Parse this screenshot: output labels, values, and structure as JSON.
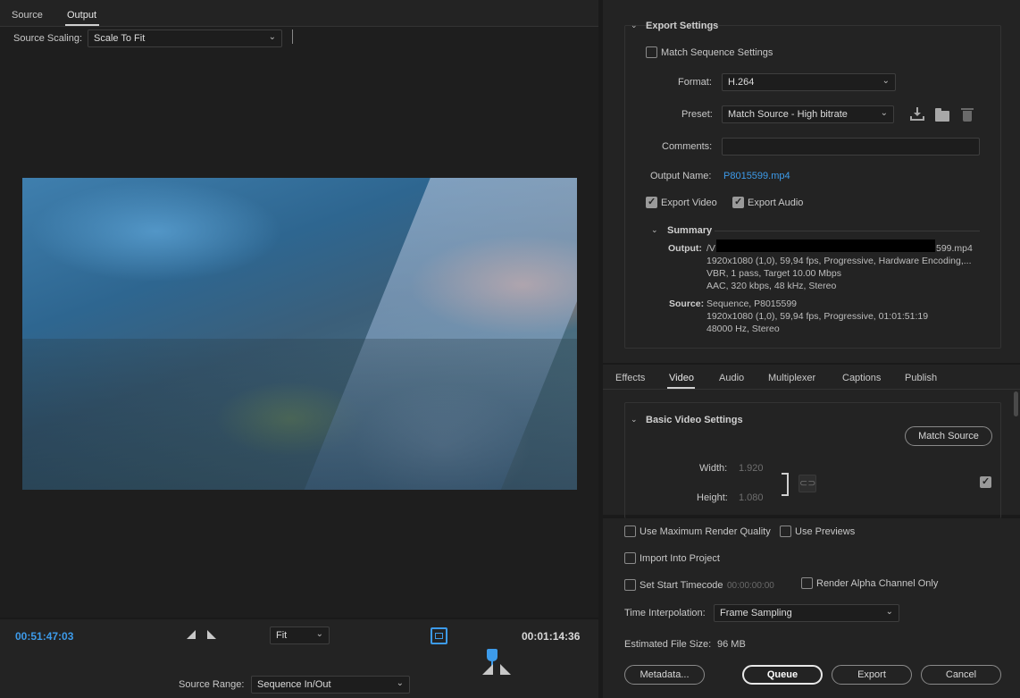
{
  "left": {
    "tabs": [
      "Source",
      "Output"
    ],
    "source_scaling_label": "Source Scaling:",
    "source_scaling_value": "Scale To Fit",
    "timecode_in": "00:51:47:03",
    "timecode_duration": "00:01:14:36",
    "zoom_value": "Fit",
    "source_range_label": "Source Range:",
    "source_range_value": "Sequence In/Out"
  },
  "export_settings": {
    "title": "Export Settings",
    "match_sequence_label": "Match Sequence Settings",
    "match_sequence_checked": false,
    "format_label": "Format:",
    "format_value": "H.264",
    "preset_label": "Preset:",
    "preset_value": "Match Source - High bitrate",
    "comments_label": "Comments:",
    "comments_value": "",
    "output_name_label": "Output Name:",
    "output_name_value": "P8015599.mp4",
    "export_video_label": "Export Video",
    "export_video_checked": true,
    "export_audio_label": "Export Audio",
    "export_audio_checked": true
  },
  "summary": {
    "title": "Summary",
    "output_label": "Output:",
    "output_path_start": "/V",
    "output_path_end": "599.mp4",
    "output_line2": "1920x1080 (1,0), 59,94 fps, Progressive, Hardware Encoding,...",
    "output_line3": "VBR, 1 pass, Target 10.00 Mbps",
    "output_line4": "AAC, 320 kbps, 48 kHz, Stereo",
    "source_label": "Source:",
    "source_line1": "Sequence, P8015599",
    "source_line2": "1920x1080 (1,0), 59,94 fps, Progressive, 01:01:51:19",
    "source_line3": "48000 Hz, Stereo"
  },
  "settings_tabs": [
    "Effects",
    "Video",
    "Audio",
    "Multiplexer",
    "Captions",
    "Publish"
  ],
  "basic_video": {
    "title": "Basic Video Settings",
    "match_source_button": "Match Source",
    "width_label": "Width:",
    "width_value": "1.920",
    "height_label": "Height:",
    "height_value": "1.080"
  },
  "bottom": {
    "max_render_label": "Use Maximum Render Quality",
    "use_previews_label": "Use Previews",
    "import_project_label": "Import Into Project",
    "set_start_tc_label": "Set Start Timecode",
    "start_tc_value": "00:00:00:00",
    "render_alpha_label": "Render Alpha Channel Only",
    "time_interp_label": "Time Interpolation:",
    "time_interp_value": "Frame Sampling",
    "est_size_label": "Estimated File Size:",
    "est_size_value": "96 MB",
    "metadata_button": "Metadata...",
    "queue_button": "Queue",
    "export_button": "Export",
    "cancel_button": "Cancel"
  },
  "colors": {
    "accent_blue": "#3d9bea",
    "panel_bg": "#232323"
  }
}
